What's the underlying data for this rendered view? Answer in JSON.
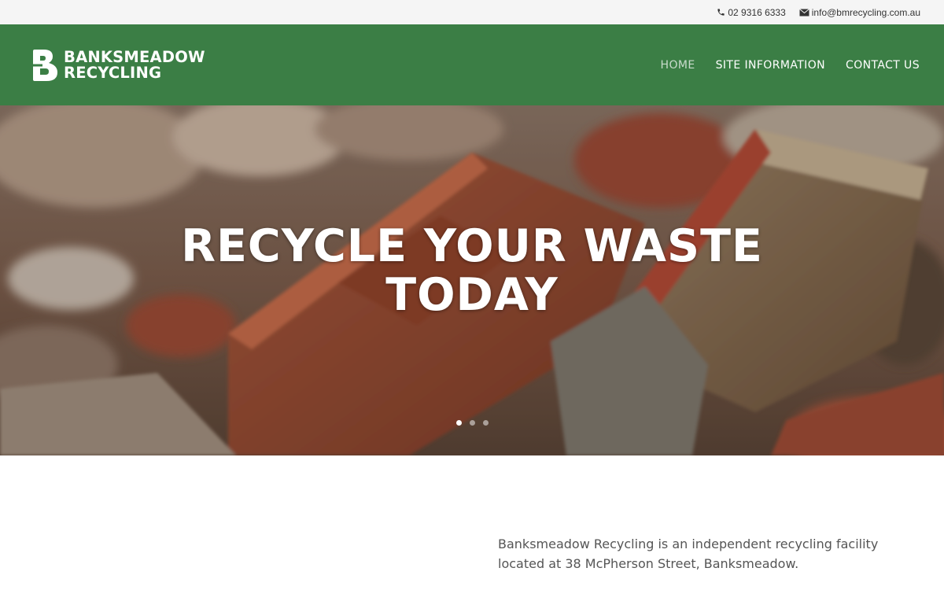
{
  "topbar": {
    "phone": "02 9316 6333",
    "phone_icon": "phone-icon",
    "email": "info@bmrecycling.com.au",
    "email_icon": "envelope-icon"
  },
  "header": {
    "logo_line1": "BANKSMEADOW",
    "logo_line2": "RECYCLING",
    "nav": [
      {
        "label": "HOME",
        "active": true
      },
      {
        "label": "SITE INFORMATION",
        "active": false
      },
      {
        "label": "CONTACT US",
        "active": false
      }
    ]
  },
  "hero": {
    "title_line1": "RECYCLE YOUR WASTE",
    "title_line2": "TODAY",
    "slides": 3,
    "active_slide": 1
  },
  "content": {
    "intro": "Banksmeadow Recycling is an independent recycling facility located at 38 McPherson Street, Banksmeadow."
  },
  "colors": {
    "header_bg": "#3b7e45",
    "topbar_bg": "#f5f5f5",
    "text": "#555555"
  }
}
